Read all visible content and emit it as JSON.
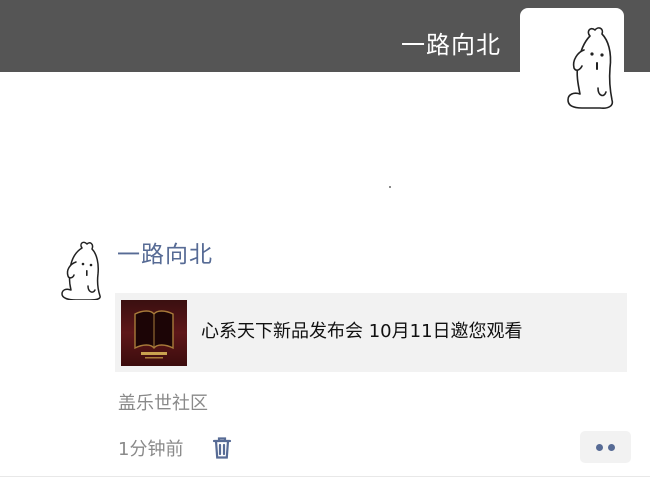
{
  "cover": {
    "user_name": "一路向北"
  },
  "post": {
    "author_name": "一路向北",
    "link": {
      "title": "心系天下新品发布会 10月11日邀您观看"
    },
    "location": "盖乐世社区",
    "time": "1分钟前"
  },
  "icons": {
    "avatar": "rabbit-avatar-icon",
    "delete": "trash-icon",
    "more": "more-dots-icon"
  },
  "colors": {
    "cover_bg": "#555555",
    "name_link": "#576b95",
    "meta_gray": "#8a8a8a",
    "card_bg": "#f2f2f2"
  }
}
